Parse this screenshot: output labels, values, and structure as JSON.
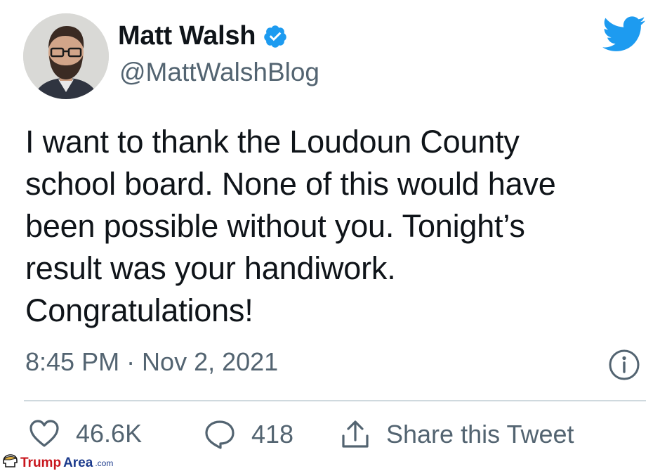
{
  "user": {
    "display_name": "Matt Walsh",
    "handle": "@MattWalshBlog",
    "verified": true,
    "avatar_icon": "profile-photo"
  },
  "tweet": {
    "text": "I want to thank the Loudoun County\nschool board. None of this would have\nbeen possible without you. Tonight’s\nresult was your handiwork.\nCongratulations!",
    "timestamp": "8:45 PM · Nov 2, 2021"
  },
  "actions": {
    "likes": "46.6K",
    "replies": "418",
    "share_label": "Share this Tweet"
  },
  "icons": {
    "brand": "twitter-bird-icon",
    "info": "info-icon",
    "like": "heart-icon",
    "reply": "speech-bubble-icon",
    "share": "share-upload-icon",
    "verified": "verified-badge-icon"
  },
  "watermark": {
    "part1": "Trump",
    "part2": "Area",
    "part3": ".com"
  },
  "colors": {
    "twitter_blue": "#1d9bf0",
    "text_primary": "#0f1419",
    "text_secondary": "#536471",
    "divider": "#cfd9de",
    "watermark_red": "#c8161d",
    "watermark_blue": "#1b3a8c"
  }
}
